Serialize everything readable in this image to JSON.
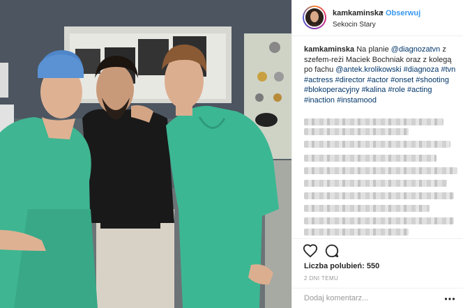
{
  "post": {
    "username": "kamkaminska",
    "separator": "•",
    "follow_label": "Obserwuj",
    "location": "Sekocin Stary"
  },
  "caption": {
    "username": "kamkaminska",
    "text_1": "Na planie",
    "mention_1": "@diagnozatvn",
    "text_2": "z szefem-reżi Maciek Bochniak oraz z kolegą po fachu",
    "mention_2": "@antek.krolikowski",
    "hashtags": [
      "#diagnoza",
      "#tvn",
      "#actress",
      "#director",
      "#actor",
      "#onset",
      "#shooting",
      "#blokoperacyjny",
      "#kalina",
      "#role",
      "#acting",
      "#inaction",
      "#instamood"
    ]
  },
  "actions": {
    "like_icon": "heart-icon",
    "comment_icon": "comment-icon",
    "likes_label": "Liczba polubień:",
    "likes_count": "550",
    "time_ago": "2 DNI TEMU",
    "comment_placeholder": "Dodaj komentarz...",
    "more_icon": "ellipsis-icon"
  }
}
